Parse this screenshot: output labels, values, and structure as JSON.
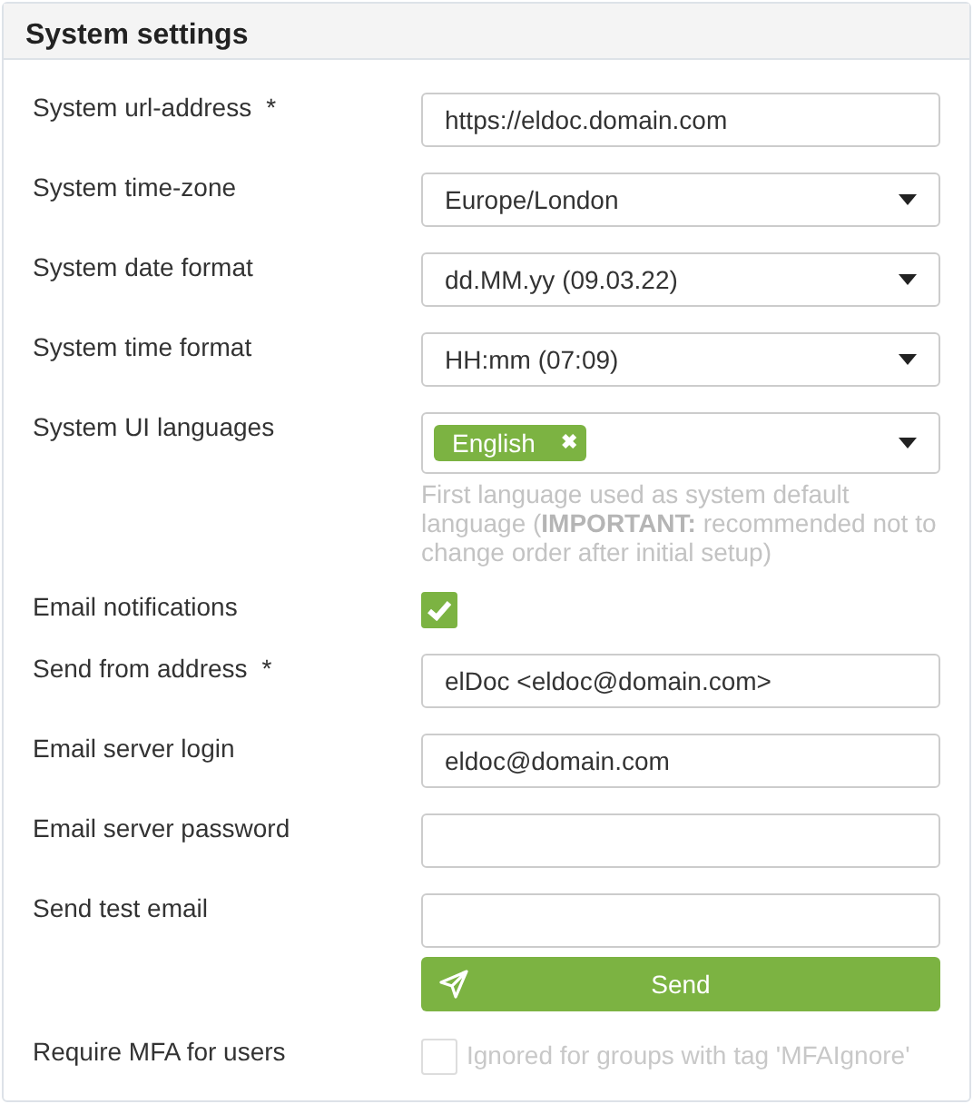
{
  "panel": {
    "title": "System settings"
  },
  "rows": [
    {
      "label": "System url-address",
      "required_mark": "*",
      "kind": "text",
      "value": "https://eldoc.domain.com"
    },
    {
      "label": "System time-zone",
      "kind": "select",
      "value": "Europe/London"
    },
    {
      "label": "System date format",
      "kind": "select",
      "value": "dd.MM.yy (09.03.22)"
    },
    {
      "label": "System time format",
      "kind": "select",
      "value": "HH:mm (07:09)"
    },
    {
      "label": "System UI languages",
      "kind": "tags",
      "tags": [
        {
          "label": "English",
          "remove": "✖"
        }
      ],
      "hint": "First language used as system default language (**IMPORTANT:** recommended not to change order after initial setup)"
    },
    {
      "label": "Email notifications",
      "kind": "checkbox",
      "checked": true,
      "disabled": false
    },
    {
      "label": "Send from address",
      "required_mark": "*",
      "kind": "text",
      "value": "elDoc <eldoc@domain.com>"
    },
    {
      "label": "Email server login",
      "kind": "text",
      "value": "eldoc@domain.com"
    },
    {
      "label": "Email server password",
      "kind": "password",
      "value": ""
    },
    {
      "label": "Send test email",
      "kind": "text",
      "value": "",
      "button": {
        "label": "Send"
      }
    },
    {
      "label": "Require MFA for users",
      "kind": "checkbox",
      "checked": false,
      "disabled": true,
      "note": "Ignored for groups with tag 'MFAIgnore'"
    }
  ]
}
